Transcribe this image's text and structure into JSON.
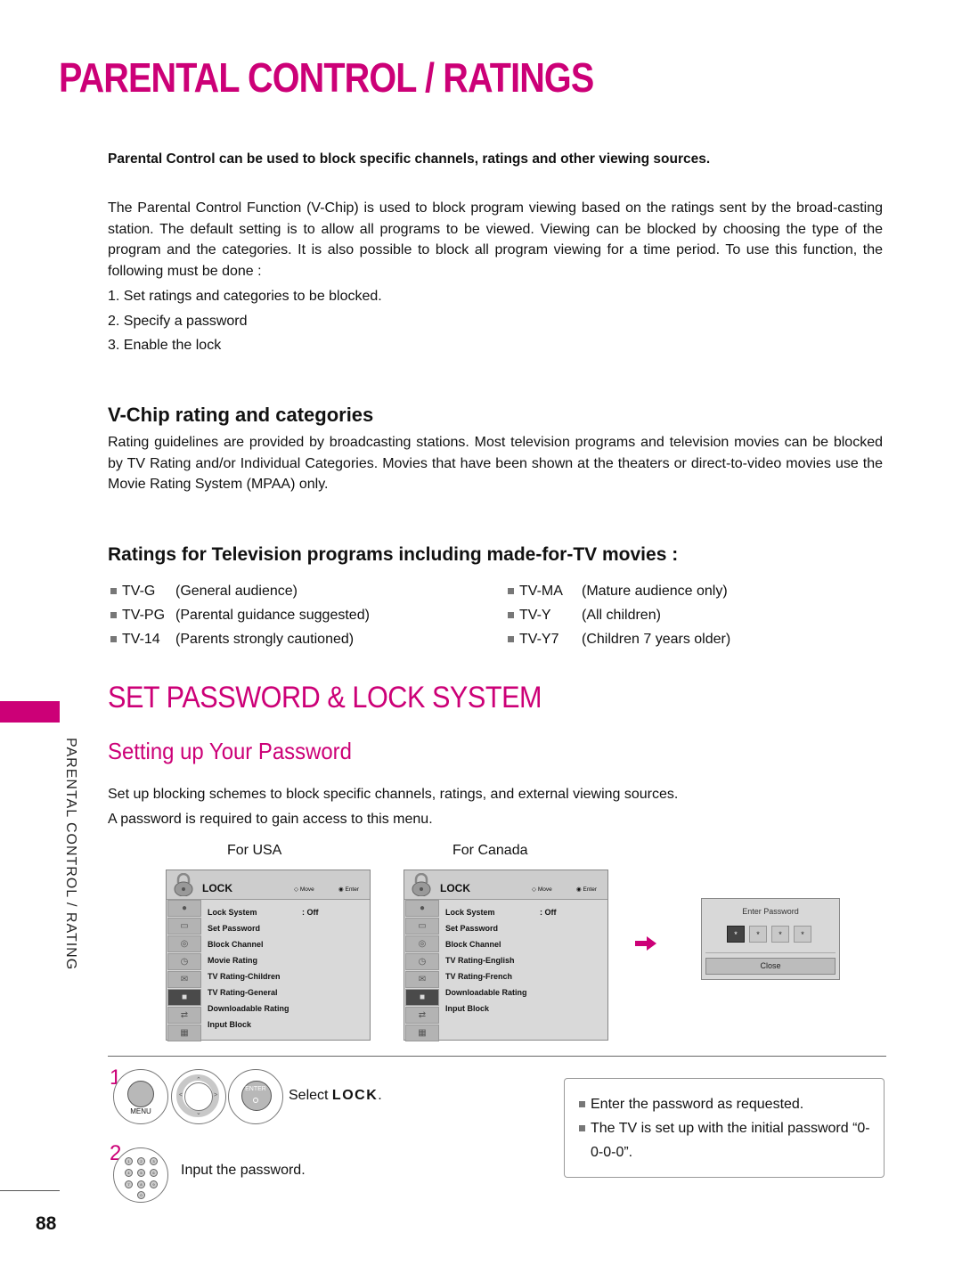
{
  "page": {
    "title": "PARENTAL CONTROL / RATINGS",
    "intro_bold": "Parental Control can be used to block specific channels, ratings and other viewing sources.",
    "intro_paragraph": "The Parental Control Function (V-Chip) is used to block program viewing based on the ratings sent by the broad-casting station. The default setting is to allow all programs to be viewed. Viewing can be blocked by choosing the type of the program and the categories. It is also possible to block all program viewing for a time period. To use this function, the following must be done :",
    "steps": [
      "1. Set ratings and categories to be blocked.",
      "2. Specify a password",
      "3. Enable the lock"
    ],
    "page_number": "88",
    "side_label": "PARENTAL CONTROL / RATING"
  },
  "vchip": {
    "heading": "V-Chip rating and categories",
    "paragraph": "Rating guidelines are provided by broadcasting stations. Most television programs and television movies can be blocked by TV Rating and/or Individual Categories. Movies that have been shown at the theaters or direct-to-video movies use the Movie Rating System (MPAA) only."
  },
  "tv_ratings": {
    "heading": "Ratings for Television programs including made-for-TV movies :",
    "left": [
      {
        "code": "TV-G",
        "desc": "(General audience)"
      },
      {
        "code": "TV-PG",
        "desc": "(Parental guidance suggested)"
      },
      {
        "code": "TV-14",
        "desc": "(Parents strongly cautioned)"
      }
    ],
    "right": [
      {
        "code": "TV-MA",
        "desc": "(Mature audience only)"
      },
      {
        "code": "TV-Y",
        "desc": "(All children)"
      },
      {
        "code": "TV-Y7",
        "desc": "(Children 7 years older)"
      }
    ]
  },
  "set_password": {
    "section_title": "SET PASSWORD & LOCK SYSTEM",
    "subtitle": "Setting up Your Password",
    "lines": [
      "Set up blocking schemes to block specific channels, ratings, and external viewing sources.",
      "A password is required to gain access to this menu."
    ],
    "label_usa": "For USA",
    "label_canada": "For Canada"
  },
  "menu_usa": {
    "title": "LOCK",
    "move": "Move",
    "enter": "Enter",
    "items": [
      "Lock System",
      "Set Password",
      "Block Channel",
      "Movie Rating",
      "TV Rating-Children",
      "TV Rating-General",
      "Downloadable Rating",
      "Input Block"
    ],
    "lock_value": ": Off"
  },
  "menu_canada": {
    "title": "LOCK",
    "move": "Move",
    "enter": "Enter",
    "items": [
      "Lock System",
      "Set Password",
      "Block Channel",
      "TV Rating-English",
      "TV Rating-French",
      "Downloadable Rating",
      "Input Block"
    ],
    "lock_value": ": Off"
  },
  "password_dialog": {
    "title": "Enter Password",
    "digits": [
      "*",
      "*",
      "*",
      "*"
    ],
    "close": "Close"
  },
  "instructions": {
    "step1_num": "1",
    "step1_prefix": "Select ",
    "step1_bold": "LOCK",
    "step1_suffix": ".",
    "menu_button": "MENU",
    "enter_button": "ENTER",
    "step2_num": "2",
    "step2_text": "Input the password.",
    "numpad_keys": [
      "1",
      "2",
      "3",
      "4",
      "5",
      "6",
      "7",
      "8",
      "9",
      "0"
    ]
  },
  "notes": [
    "Enter the password as requested.",
    "The TV is set up with the initial password “0-0-0-0”."
  ],
  "colors": {
    "accent": "#cc0077"
  }
}
